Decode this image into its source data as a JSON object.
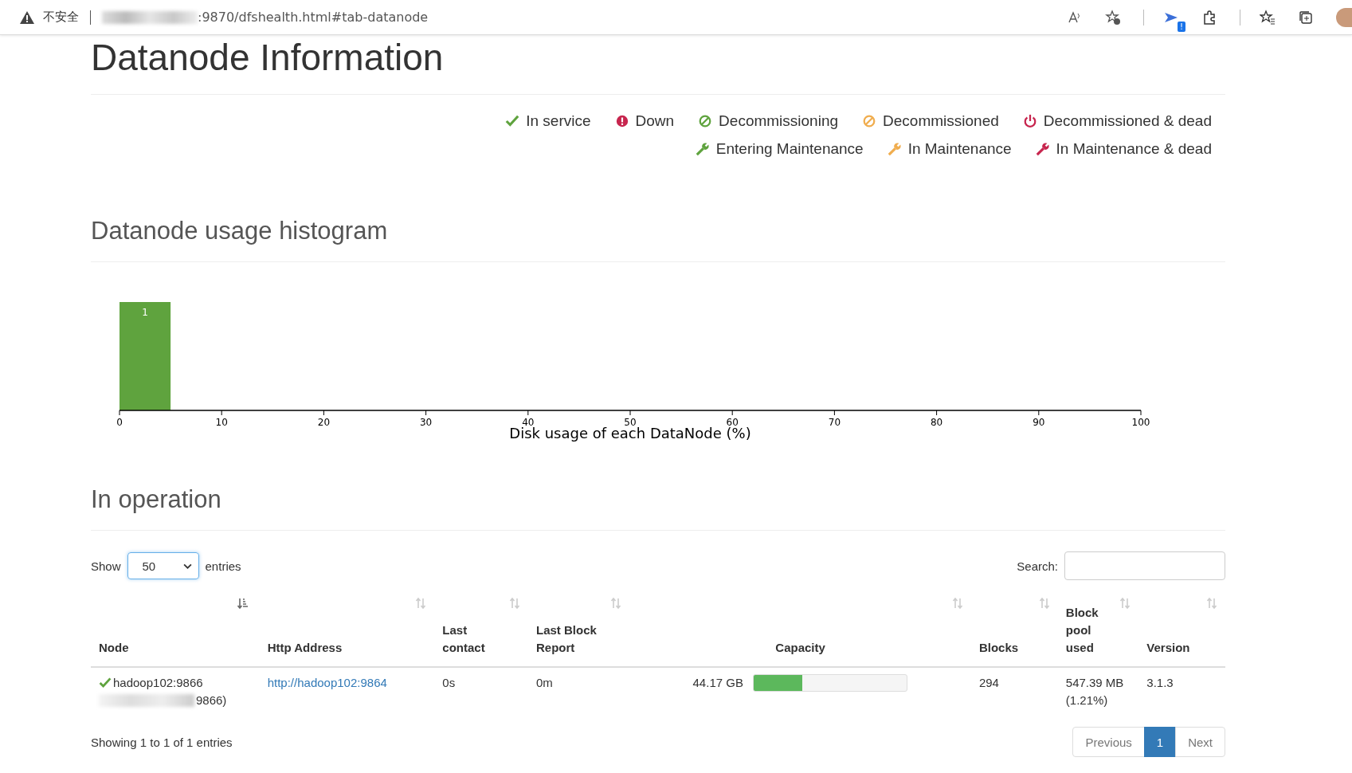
{
  "browser": {
    "security_label": "不安全",
    "address": ":9870/dfshealth.html#tab-datanode",
    "extension_badge": "!"
  },
  "page_title": "Datanode Information",
  "legend": [
    {
      "label": "In service",
      "kind": "check",
      "color": "#5fa33e"
    },
    {
      "label": "Down",
      "kind": "alert",
      "color": "#c7254e"
    },
    {
      "label": "Decommissioning",
      "kind": "ban",
      "color": "#5fa33e"
    },
    {
      "label": "Decommissioned",
      "kind": "ban",
      "color": "#f0ad4e"
    },
    {
      "label": "Decommissioned & dead",
      "kind": "power",
      "color": "#c7254e"
    },
    {
      "label": "Entering Maintenance",
      "kind": "wrench",
      "color": "#5fa33e"
    },
    {
      "label": "In Maintenance",
      "kind": "wrench",
      "color": "#f0ad4e"
    },
    {
      "label": "In Maintenance & dead",
      "kind": "wrench",
      "color": "#c7254e"
    }
  ],
  "histogram": {
    "heading": "Datanode usage histogram",
    "chart_data": {
      "type": "bar",
      "xlabel": "Disk usage of each DataNode (%)",
      "x": [
        2.5
      ],
      "values": [
        1
      ],
      "xlim": [
        0,
        100
      ],
      "xticks": [
        0,
        10,
        20,
        30,
        40,
        50,
        60,
        70,
        80,
        90,
        100
      ],
      "data_labels": true
    }
  },
  "operation": {
    "heading": "In operation",
    "length": {
      "before": "Show",
      "value": "50",
      "after": "entries"
    },
    "search": {
      "label": "Search:"
    },
    "columns": [
      {
        "label": "Node",
        "sorted": true
      },
      {
        "label": "Http Address",
        "sorted": false
      },
      {
        "label": "Last contact",
        "sorted": false
      },
      {
        "label": "Last Block Report",
        "sorted": false
      },
      {
        "label": "Capacity",
        "sorted": false
      },
      {
        "label": "Blocks",
        "sorted": false
      },
      {
        "label": "Block pool used",
        "sorted": false
      },
      {
        "label": "Version",
        "sorted": false
      }
    ],
    "rows": [
      {
        "node": "hadoop102:9866",
        "node_detail": "9866)",
        "http": "http://hadoop102:9864",
        "last_contact": "0s",
        "last_block_report": "0m",
        "capacity": "44.17 GB",
        "level": 0.32,
        "blocks": "294",
        "pool_used": "547.39 MB (1.21%)",
        "version": "3.1.3"
      }
    ],
    "info": "Showing 1 to 1 of 1 entries",
    "pages": [
      {
        "label": "Previous",
        "selected": false
      },
      {
        "label": "1",
        "selected": true
      },
      {
        "label": "Next",
        "selected": false
      }
    ]
  }
}
